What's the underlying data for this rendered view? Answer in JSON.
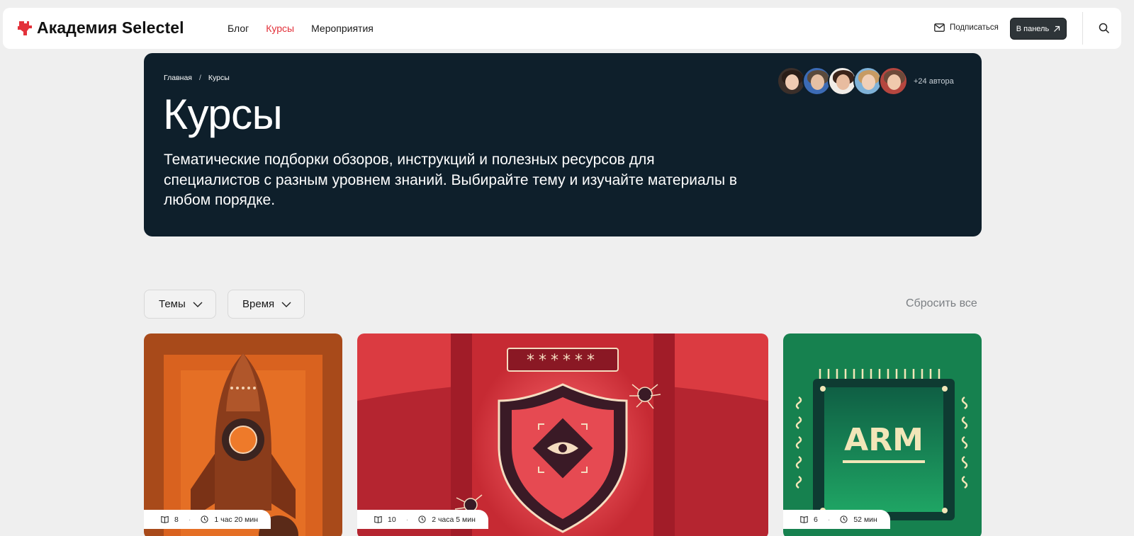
{
  "header": {
    "logo_text": "Академия Selectel",
    "nav": [
      {
        "label": "Блог",
        "active": false
      },
      {
        "label": "Курсы",
        "active": true
      },
      {
        "label": "Мероприятия",
        "active": false
      }
    ],
    "subscribe_label": "Подписаться",
    "panel_label": "В панель",
    "icons": [
      "logo-icon",
      "mail-icon",
      "arrow-up-right-icon",
      "search-icon"
    ]
  },
  "hero": {
    "breadcrumb": [
      "Главная",
      "Курсы"
    ],
    "breadcrumb_separator": "/",
    "title": "Курсы",
    "description": "Тематические подборки обзоров, инструкций и полезных ресурсов для специалистов с разным уровнем знаний. Выбирайте тему и изучайте материалы в любом порядке.",
    "authors_label": "+24 автора"
  },
  "filters": {
    "topics_label": "Темы",
    "time_label": "Время",
    "reset_label": "Сбросить все"
  },
  "cards": [
    {
      "articles": "8",
      "duration": "1 час 20 мин",
      "art": "rocket"
    },
    {
      "articles": "10",
      "duration": "2 часа 5 мин",
      "art": "shield",
      "password_mask": "******"
    },
    {
      "articles": "6",
      "duration": "52 мин",
      "art": "arm-chip",
      "chip_label": "ARM"
    }
  ],
  "colors": {
    "accent_red": "#e3323b",
    "hero_bg": "#0e1f2b",
    "card_orange": "#c9541c",
    "card_red": "#d8363c",
    "card_green": "#16814f"
  }
}
